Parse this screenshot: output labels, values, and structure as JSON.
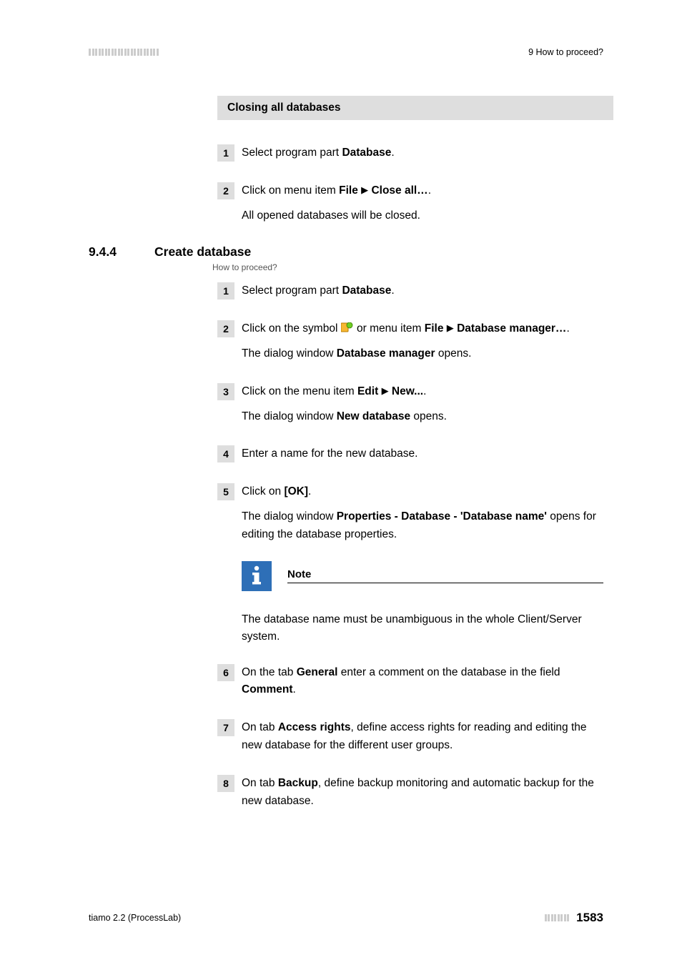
{
  "header": {
    "right": "9 How to proceed?"
  },
  "section1": {
    "heading": "Closing all databases",
    "steps": [
      {
        "num": "1",
        "a": "Select program part ",
        "b": "Database",
        "c": "."
      },
      {
        "num": "2",
        "a": "Click on menu item ",
        "b": "File",
        "c": "Close all…",
        "d": ".",
        "result": "All opened databases will be closed."
      }
    ]
  },
  "section2": {
    "num": "9.4.4",
    "title": "Create database",
    "howto": "How to proceed?",
    "steps": {
      "s1": {
        "num": "1",
        "a": "Select program part ",
        "b": "Database",
        "c": "."
      },
      "s2": {
        "num": "2",
        "a": "Click on the symbol ",
        "b": " or menu item ",
        "c": "File",
        "d": "Database manager…",
        "e": ".",
        "result_a": "The dialog window ",
        "result_b": "Database manager",
        "result_c": " opens."
      },
      "s3": {
        "num": "3",
        "a": "Click on the menu item ",
        "b": "Edit",
        "c": "New...",
        "d": ".",
        "result_a": "The dialog window ",
        "result_b": "New database",
        "result_c": " opens."
      },
      "s4": {
        "num": "4",
        "a": "Enter a name for the new database."
      },
      "s5": {
        "num": "5",
        "a": "Click on ",
        "b": "[OK]",
        "c": ".",
        "result_a": "The dialog window ",
        "result_b": "Properties - Database - 'Database name'",
        "result_c": " opens for editing the database properties."
      },
      "s6": {
        "num": "6",
        "a": "On the tab ",
        "b": "General",
        "c": " enter a comment on the database in the field ",
        "d": "Comment",
        "e": "."
      },
      "s7": {
        "num": "7",
        "a": "On tab ",
        "b": "Access rights",
        "c": ", define access rights for reading and editing the new database for the different user groups."
      },
      "s8": {
        "num": "8",
        "a": "On tab ",
        "b": "Backup",
        "c": ", define backup monitoring and automatic backup for the new database."
      }
    },
    "note": {
      "title": "Note",
      "body": "The database name must be unambiguous in the whole Client/Server system."
    }
  },
  "footer": {
    "left": "tiamo 2.2 (ProcessLab)",
    "page": "1583"
  },
  "glyphs": {
    "arrow": "▶"
  }
}
